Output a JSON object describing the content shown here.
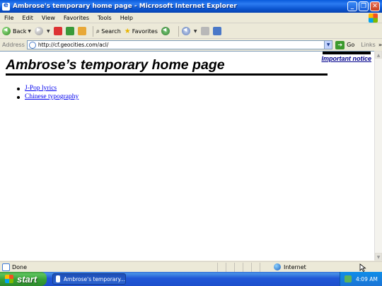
{
  "window": {
    "title": "Ambrose's temporary home page - Microsoft Internet Explorer",
    "controls": [
      "minimize",
      "restore",
      "close"
    ]
  },
  "menu": {
    "items": [
      "File",
      "Edit",
      "View",
      "Favorites",
      "Tools",
      "Help"
    ]
  },
  "toolbar": {
    "back_label": "Back",
    "search_label": "Search",
    "favorites_label": "Favorites"
  },
  "address": {
    "label": "Address",
    "value": "http://cf.geocities.com/acl/",
    "go_label": "Go",
    "links_label": "Links"
  },
  "page": {
    "notice_link": "Important notice",
    "heading": "Ambrose’s temporary home page",
    "links": [
      "J-Pop lyrics",
      "Chinese typography"
    ]
  },
  "status": {
    "text": "Done",
    "zone": "Internet"
  },
  "taskbar": {
    "start_label": "start",
    "task_label": "Ambrose's temporary...",
    "clock": "4:09 AM"
  },
  "colors": {
    "titlebar_blue": "#0A5BDB",
    "link_blue": "#0000EE",
    "start_green": "#3C9B3C",
    "taskbar_blue": "#2157D7"
  }
}
